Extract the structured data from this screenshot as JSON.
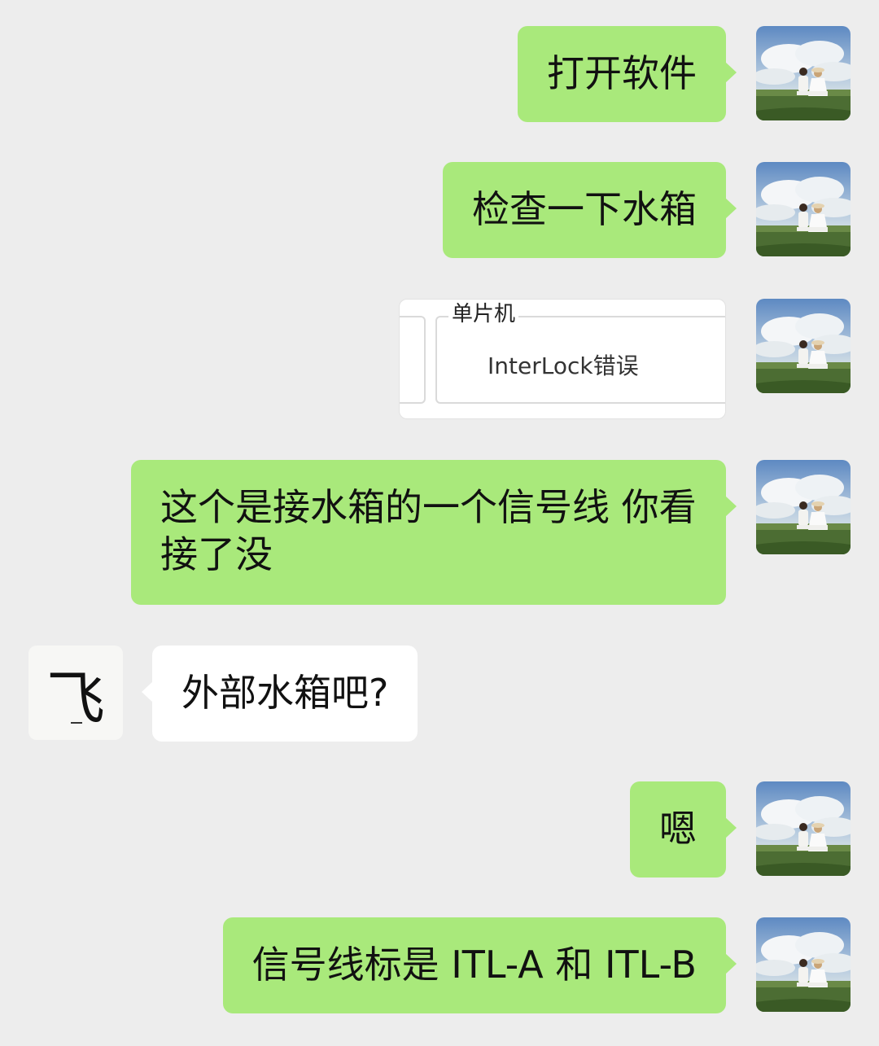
{
  "messages": [
    {
      "sender": "me",
      "type": "text",
      "text": "打开软件"
    },
    {
      "sender": "me",
      "type": "text",
      "text": "检查一下水箱"
    },
    {
      "sender": "me",
      "type": "image",
      "group_title": "单片机",
      "error_text": "InterLock错误"
    },
    {
      "sender": "me",
      "type": "text",
      "text": "这个是接水箱的一个信号线 你看接了没"
    },
    {
      "sender": "other",
      "type": "text",
      "text": "外部水箱吧?"
    },
    {
      "sender": "me",
      "type": "text",
      "text": "嗯"
    },
    {
      "sender": "me",
      "type": "text",
      "text": "信号线标是 ITL-A 和 ITL-B"
    }
  ],
  "avatars": {
    "me": {
      "icon": "couple-photo-avatar"
    },
    "other": {
      "icon": "calligraphy-avatar",
      "text": "飞"
    }
  },
  "colors": {
    "background": "#ededed",
    "my_bubble": "#a9e97b",
    "their_bubble": "#ffffff"
  }
}
